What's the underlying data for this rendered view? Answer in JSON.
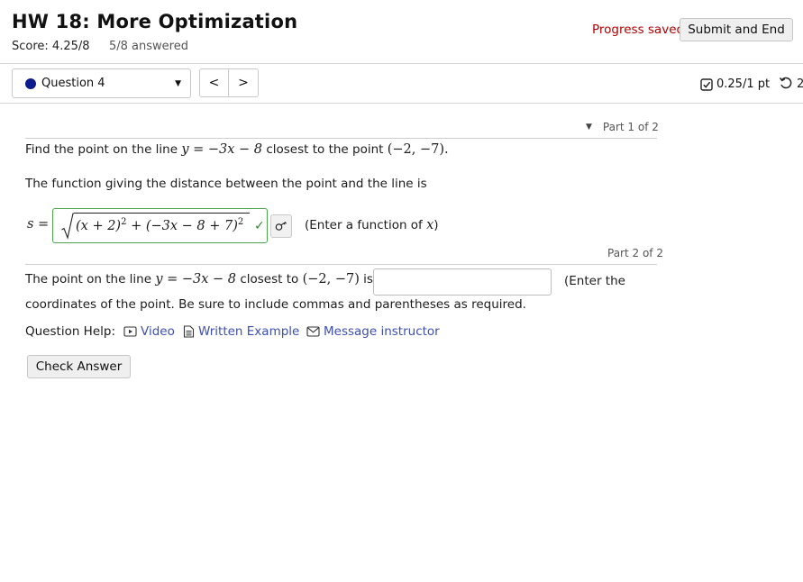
{
  "header": {
    "title": "HW 18: More Optimization",
    "score": "Score: 4.25/8",
    "answered": "5/8 answered",
    "progress_status": "Progress saved",
    "submit_label": "Submit and End"
  },
  "nav": {
    "question_label": "Question 4",
    "prev_label": "<",
    "next_label": ">",
    "points": "0.25/1 pt",
    "retry_count": "2"
  },
  "part1": {
    "header": "Part 1 of 2",
    "prompt_pre": "Find the point on the line ",
    "line_eq": "y = −3x − 8",
    "prompt_mid": " closest to the point ",
    "point": "(−2, −7).",
    "distance_text": "The function giving the distance between the point and the line is",
    "var_label": "s =",
    "answer_expr_a": "(x + 2)",
    "answer_expr_b": " + (−3x − 8 + 7)",
    "exponent": "2",
    "enter_hint_pre": "(Enter a function of ",
    "enter_hint_var": "x",
    "enter_hint_post": ")"
  },
  "part2": {
    "header": "Part 2 of 2",
    "prompt_pre": "The point on the line ",
    "line_eq": "y = −3x − 8",
    "prompt_mid": " closest to ",
    "point": "(−2, −7)",
    "prompt_is": " is",
    "input_value": "",
    "enter_hint": "(Enter the",
    "continued": "coordinates of the point. Be sure to include commas and parentheses as required."
  },
  "help": {
    "label": "Question Help:",
    "video": "Video",
    "written_example": "Written Example",
    "message": "Message instructor"
  },
  "check_answer_label": "Check Answer"
}
